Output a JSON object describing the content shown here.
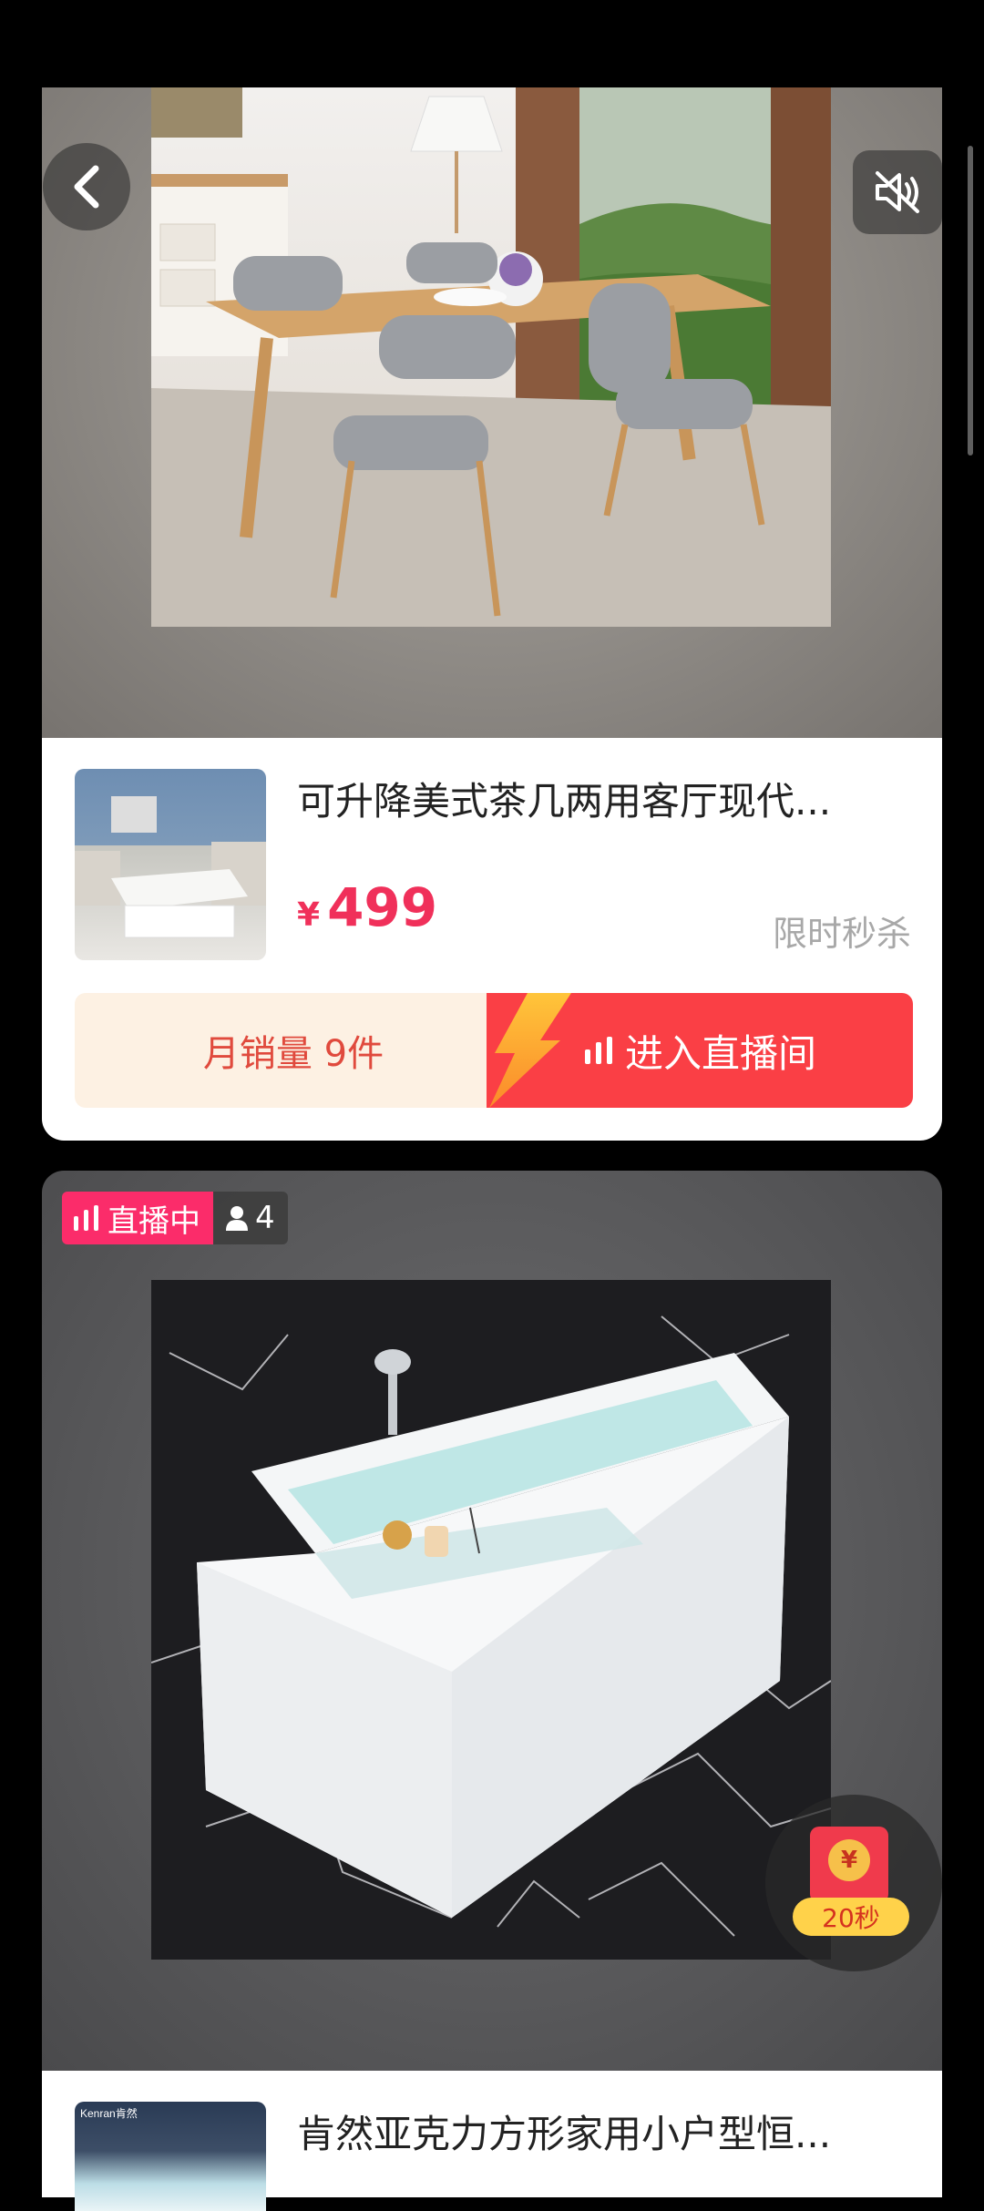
{
  "products": [
    {
      "title": "可升降美式茶几两用客厅现代...",
      "currency": "¥",
      "price": "499",
      "promo_tag": "限时秒杀",
      "monthly_sales": "月销量 9件",
      "live_button_label": "进入直播间"
    },
    {
      "live_status": "直播中",
      "viewer_count": "4",
      "title": "肯然亚克力方形家用小户型恒...",
      "thumb_brand": "Kenran肯然"
    }
  ],
  "red_packet": {
    "coin_symbol": "¥",
    "timer": "20秒"
  },
  "icons": [
    "back-arrow-icon",
    "mute-icon",
    "live-bars-icon",
    "person-icon",
    "lightning-icon",
    "red-packet-icon"
  ],
  "colors": {
    "price_red": "#f0305a",
    "live_button_red": "#fa3f45",
    "live_badge_pink": "#fb2c6a",
    "sales_bg": "#fdf1e3",
    "sales_text": "#e04a3d"
  }
}
